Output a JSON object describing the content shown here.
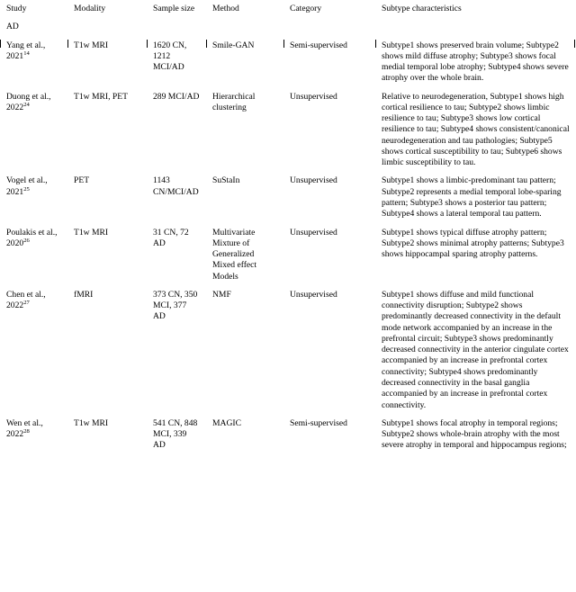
{
  "table": {
    "columns": [
      {
        "key": "study",
        "label": "Study"
      },
      {
        "key": "modality",
        "label": "Modality"
      },
      {
        "key": "sample",
        "label": "Sample size"
      },
      {
        "key": "method",
        "label": "Method"
      },
      {
        "key": "category",
        "label": "Category"
      },
      {
        "key": "subtype",
        "label": "Subtype characteristics"
      }
    ],
    "sections": [
      {
        "label": "AD"
      }
    ],
    "rows": [
      {
        "study": "Yang et al., 2021",
        "study_ref": "14",
        "modality": "T1w MRI",
        "sample": "1620 CN, 1212 MCI/AD",
        "method": "Smile-GAN",
        "category": "Semi-supervised",
        "subtype": "Subtype1 shows preserved brain volume; Subtype2 shows mild diffuse atrophy; Subtype3 shows focal medial temporal lobe atrophy; Subtype4 shows severe atrophy over the whole brain."
      },
      {
        "study": "Duong et al., 2022",
        "study_ref": "24",
        "modality": "T1w MRI, PET",
        "sample": "289 MCI/AD",
        "method": "Hierarchical clustering",
        "category": "Unsupervised",
        "subtype": "Relative to neurodegeneration, Subtype1 shows high cortical resilience to tau; Subtype2 shows limbic resilience to tau; Subtype3 shows low cortical resilience to tau; Subtype4 shows consistent/canonical neurodegeneration and tau pathologies; Subtype5 shows cortical susceptibility to tau; Subtype6 shows limbic susceptibility to tau."
      },
      {
        "study": "Vogel et al., 2021",
        "study_ref": "25",
        "modality": "PET",
        "sample": "1143 CN/MCI/AD",
        "method": "SuStaIn",
        "category": "Unsupervised",
        "subtype": "Subtype1 shows a limbic-predominant tau pattern; Subtype2 represents a medial temporal lobe-sparing pattern; Subtype3 shows a posterior tau pattern; Subtype4 shows a lateral temporal tau pattern."
      },
      {
        "study": "Poulakis et al., 2020",
        "study_ref": "26",
        "modality": "T1w MRI",
        "sample": "31 CN, 72 AD",
        "method": "Multivariate Mixture of Generalized Mixed effect Models",
        "category": "Unsupervised",
        "subtype": "Subtype1 shows typical diffuse atrophy pattern; Subtype2 shows minimal atrophy patterns; Subtype3 shows hippocampal sparing atrophy patterns."
      },
      {
        "study": "Chen et al., 2022",
        "study_ref": "27",
        "modality": "fMRI",
        "sample": "373 CN, 350 MCI, 377 AD",
        "method": "NMF",
        "category": "Unsupervised",
        "subtype": "Subtype1 shows diffuse and mild functional connectivity disruption; Subtype2 shows predominantly decreased connectivity in the default mode network accompanied by an increase in the prefrontal circuit; Subtype3 shows predominantly decreased connectivity in the anterior cingulate cortex accompanied by an increase in prefrontal cortex connectivity; Subtype4 shows predominantly decreased connectivity in the basal ganglia accompanied by an increase in prefrontal cortex connectivity."
      },
      {
        "study": "Wen et al., 2022",
        "study_ref": "28",
        "modality": "T1w MRI",
        "sample": "541 CN, 848 MCI, 339 AD",
        "method": "MAGIC",
        "category": "Semi-supervised",
        "subtype": "Subtype1 shows focal atrophy in temporal regions; Subtype2 shows whole-brain atrophy with the most severe atrophy in temporal and hippocampus regions;"
      }
    ]
  }
}
